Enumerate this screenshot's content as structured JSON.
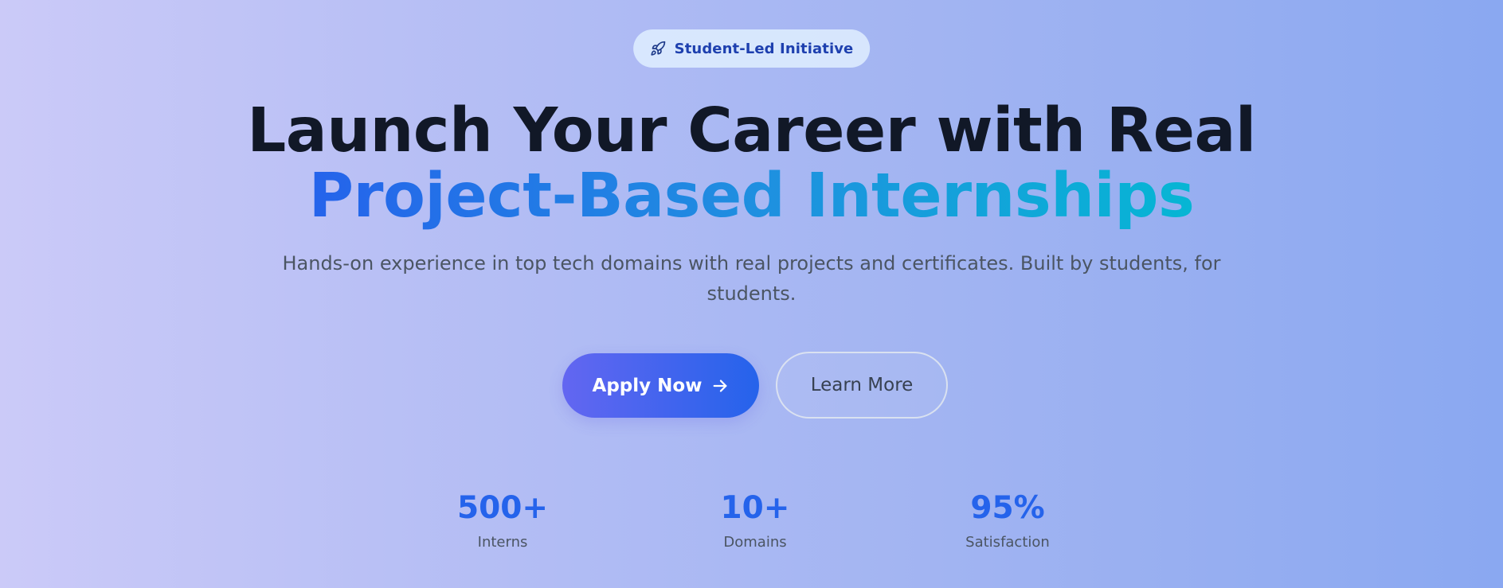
{
  "badge": {
    "icon": "rocket-icon",
    "label": "Student-Led Initiative"
  },
  "hero": {
    "headline": "Launch Your Career with Real",
    "headline_accent": "Project-Based Internships",
    "subtitle": "Hands-on experience in top tech domains with real projects and certificates. Built by students, for students."
  },
  "actions": {
    "apply_label": "Apply Now",
    "apply_icon": "arrow-right-icon",
    "learn_label": "Learn More"
  },
  "stats": [
    {
      "value": "500+",
      "label": "Interns"
    },
    {
      "value": "10+",
      "label": "Domains"
    },
    {
      "value": "95%",
      "label": "Satisfaction"
    }
  ],
  "colors": {
    "accent_blue": "#2563eb",
    "accent_indigo": "#6366f1",
    "accent_cyan": "#06b6d4",
    "headline_dark": "#111827",
    "badge_text": "#1e40af"
  }
}
